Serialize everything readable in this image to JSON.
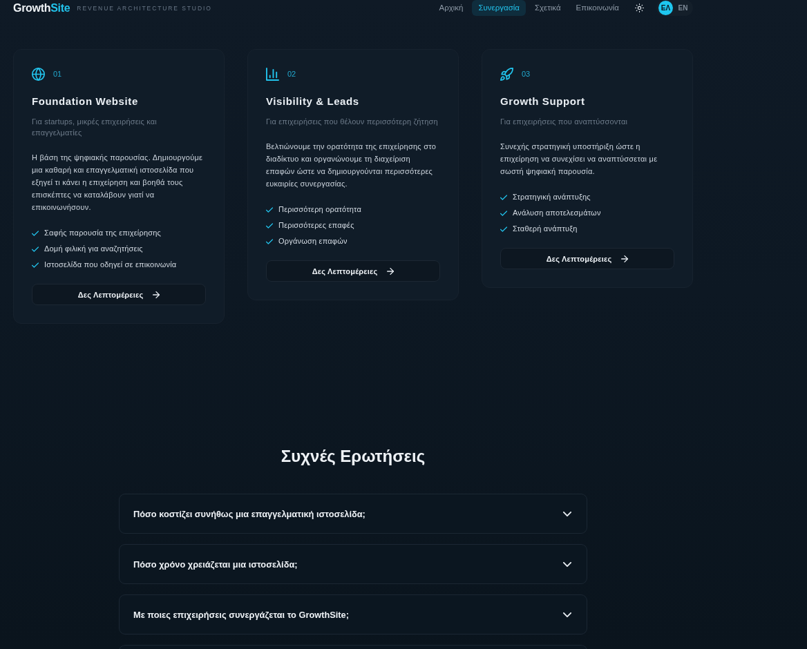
{
  "header": {
    "logo": {
      "text": "Growth",
      "accent": "Site"
    },
    "tagline": "REVENUE ARCHITECTURE STUDIO",
    "nav": [
      {
        "label": "Αρχική",
        "selected": false
      },
      {
        "label": "Συνεργασία",
        "selected": true
      },
      {
        "label": "Σχετικά",
        "selected": false
      },
      {
        "label": "Επικοινωνία",
        "selected": false
      }
    ],
    "languages": [
      {
        "label": "ΕΛ",
        "selected": true
      },
      {
        "label": "EN",
        "selected": false
      }
    ]
  },
  "services": [
    {
      "number": "01",
      "title": "Foundation Website",
      "audience": "Για startups, μικρές επιχειρήσεις και επαγγελματίες",
      "description": "Η βάση της ψηφιακής παρουσίας. Δημιουργούμε μια καθαρή και επαγγελματική ιστοσελίδα που εξηγεί τι κάνει η επιχείρηση και βοηθά τους επισκέπτες να καταλάβουν γιατί να επικοινωνήσουν.",
      "features": [
        "Σαφής παρουσία της επιχείρησης",
        "Δομή φιλική για αναζητήσεις",
        "Ιστοσελίδα που οδηγεί σε επικοινωνία"
      ],
      "button": "Δες Λεπτομέρειες"
    },
    {
      "number": "02",
      "title": "Visibility & Leads",
      "audience": "Για επιχειρήσεις που θέλουν περισσότερη ζήτηση",
      "description": "Βελτιώνουμε την ορατότητα της επιχείρησης στο διαδίκτυο και οργανώνουμε τη διαχείριση επαφών ώστε να δημιουργούνται περισσότερες ευκαιρίες συνεργασίας.",
      "features": [
        "Περισσότερη ορατότητα",
        "Περισσότερες επαφές",
        "Οργάνωση επαφών"
      ],
      "button": "Δες Λεπτομέρειες"
    },
    {
      "number": "03",
      "title": "Growth Support",
      "audience": "Για επιχειρήσεις που αναπτύσσονται",
      "description": "Συνεχής στρατηγική υποστήριξη ώστε η επιχείρηση να συνεχίσει να αναπτύσσεται με σωστή ψηφιακή παρουσία.",
      "features": [
        "Στρατηγική ανάπτυξης",
        "Ανάλυση αποτελεσμάτων",
        "Σταθερή ανάπτυξη"
      ],
      "button": "Δες Λεπτομέρειες"
    }
  ],
  "faq": {
    "title": "Συχνές Ερωτήσεις",
    "items": [
      {
        "question": "Πόσο κοστίζει συνήθως μια επαγγελματική ιστοσελίδα;",
        "expanded": false
      },
      {
        "question": "Πόσο χρόνο χρειάζεται μια ιστοσελίδα;",
        "expanded": false
      },
      {
        "question": "Με ποιες επιχειρήσεις συνεργάζεται το GrowthSite;",
        "expanded": false
      }
    ],
    "next_item_peeking": true
  }
}
